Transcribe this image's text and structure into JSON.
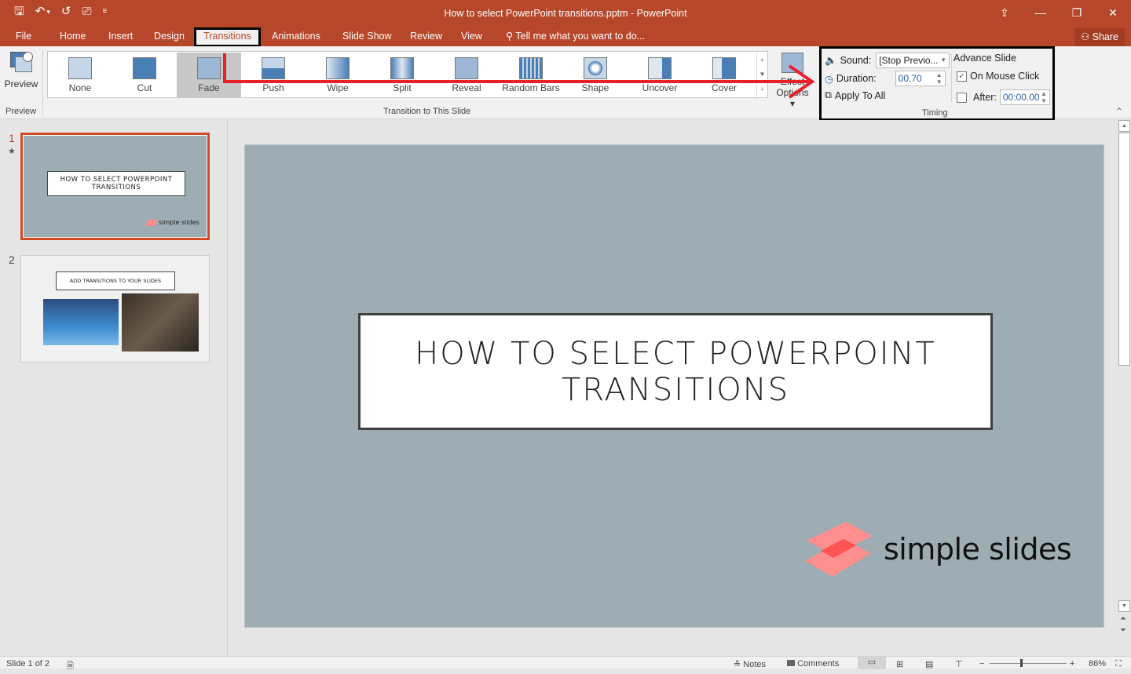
{
  "app": {
    "window_title": "How to select PowerPoint transitions.pptm - PowerPoint",
    "quick_access": [
      {
        "name": "save-icon",
        "glyph": "🖫"
      },
      {
        "name": "undo-icon",
        "glyph": "↶"
      },
      {
        "name": "undo-dropdown-icon",
        "glyph": "▾"
      },
      {
        "name": "redo-icon",
        "glyph": "↺"
      },
      {
        "name": "start-slideshow-icon",
        "glyph": "⎚"
      },
      {
        "name": "customize-qat-icon",
        "glyph": "≡"
      }
    ],
    "window_controls": {
      "ribbon_display": "⇪",
      "minimize": "—",
      "restore": "❐",
      "close": "✕"
    }
  },
  "tabs": [
    {
      "label": "File"
    },
    {
      "label": "Home"
    },
    {
      "label": "Insert"
    },
    {
      "label": "Design"
    },
    {
      "label": "Transitions",
      "active": true
    },
    {
      "label": "Animations"
    },
    {
      "label": "Slide Show"
    },
    {
      "label": "Review"
    },
    {
      "label": "View"
    }
  ],
  "tell_me": "Tell me what you want to do...",
  "share_label": "Share",
  "ribbon": {
    "preview": {
      "button_label": "Preview",
      "group_label": "Preview"
    },
    "transitions": {
      "group_label": "Transition to This Slide",
      "items": [
        {
          "label": "None"
        },
        {
          "label": "Cut"
        },
        {
          "label": "Fade",
          "selected": true
        },
        {
          "label": "Push"
        },
        {
          "label": "Wipe"
        },
        {
          "label": "Split"
        },
        {
          "label": "Reveal"
        },
        {
          "label": "Random Bars"
        },
        {
          "label": "Shape"
        },
        {
          "label": "Uncover"
        },
        {
          "label": "Cover"
        }
      ],
      "effect_options_label": "Effect Options"
    },
    "timing": {
      "group_label": "Timing",
      "sound_label": "Sound:",
      "sound_value": "[Stop Previo...",
      "duration_label": "Duration:",
      "duration_value": "00.70",
      "apply_all_label": "Apply To All",
      "advance_label": "Advance Slide",
      "on_mouse_click_label": "On Mouse Click",
      "on_mouse_click_checked": true,
      "after_label": "After:",
      "after_checked": false,
      "after_value": "00:00.00"
    }
  },
  "slides": [
    {
      "number": "1",
      "title": "HOW TO SELECT POWERPOINT TRANSITIONS",
      "logo": "simple slides",
      "has_transition": true,
      "selected": true
    },
    {
      "number": "2",
      "title": "ADD TRANSITIONS TO YOUR SLIDES",
      "selected": false
    }
  ],
  "current_slide": {
    "title_line1": "HOW TO SELECT POWERPOINT",
    "title_line2": "TRANSITIONS",
    "logo_text": "simple slides",
    "background": "#9dadb3",
    "logo_color": "#ff8a8a"
  },
  "status": {
    "slide_count": "Slide 1 of 2",
    "notes_label": "Notes",
    "comments_label": "Comments",
    "zoom": "86%"
  },
  "colors": {
    "accent": "#b7472a",
    "annotation": "#e8202a"
  }
}
